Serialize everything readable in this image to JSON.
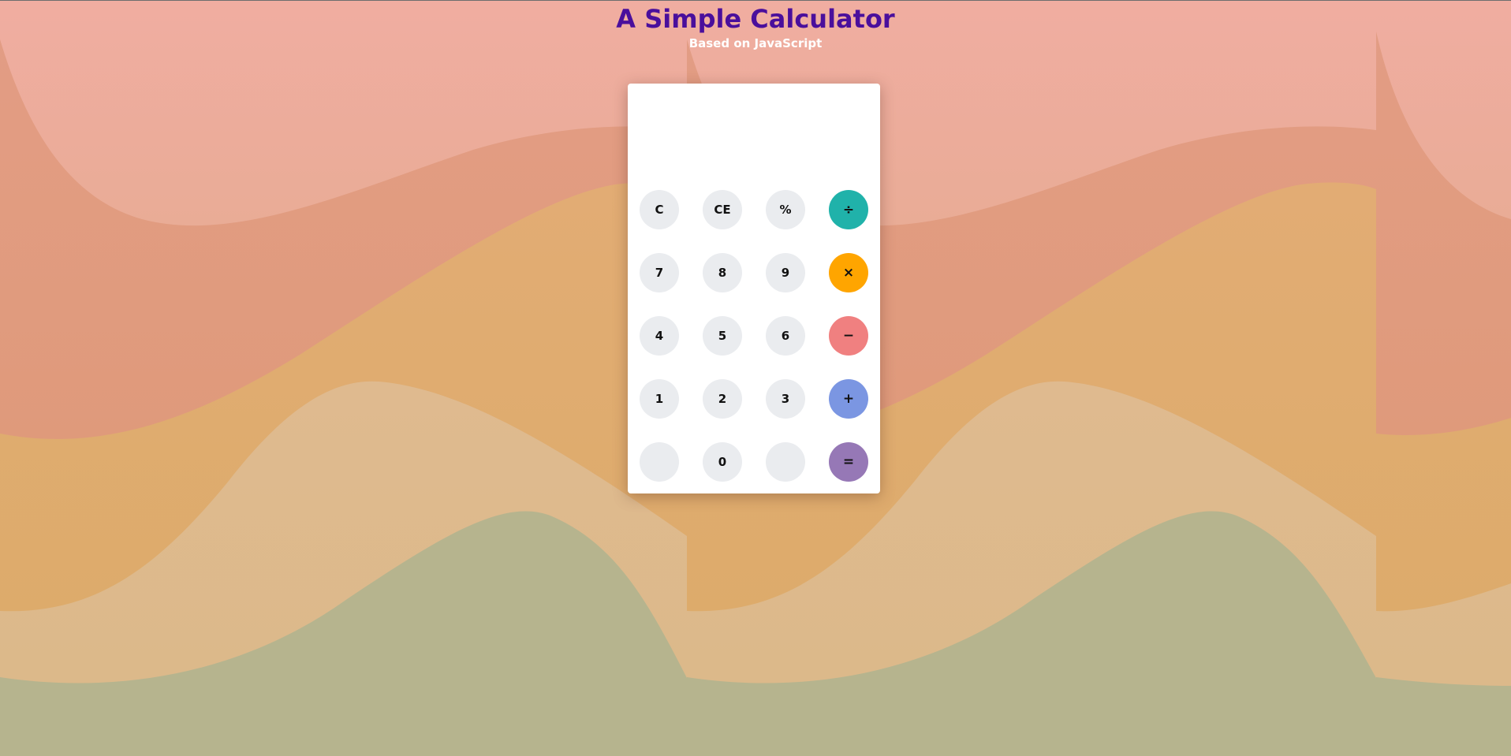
{
  "header": {
    "title": "A Simple Calculator",
    "subtitle": "Based on JavaScript"
  },
  "calculator": {
    "display_value": "",
    "keys": [
      {
        "label": "C",
        "color": "#eaecef"
      },
      {
        "label": "CE",
        "color": "#eaecef"
      },
      {
        "label": "%",
        "color": "#eaecef"
      },
      {
        "label": "÷",
        "color": "#20b2aa"
      },
      {
        "label": "7",
        "color": "#eaecef"
      },
      {
        "label": "8",
        "color": "#eaecef"
      },
      {
        "label": "9",
        "color": "#eaecef"
      },
      {
        "label": "×",
        "color": "#ffa500"
      },
      {
        "label": "4",
        "color": "#eaecef"
      },
      {
        "label": "5",
        "color": "#eaecef"
      },
      {
        "label": "6",
        "color": "#eaecef"
      },
      {
        "label": "−",
        "color": "#f08080"
      },
      {
        "label": "1",
        "color": "#eaecef"
      },
      {
        "label": "2",
        "color": "#eaecef"
      },
      {
        "label": "3",
        "color": "#eaecef"
      },
      {
        "label": "+",
        "color": "#7b96e2"
      },
      {
        "label": "",
        "color": "#eaecef"
      },
      {
        "label": "0",
        "color": "#eaecef"
      },
      {
        "label": "",
        "color": "#eaecef"
      },
      {
        "label": "=",
        "color": "#9678b6"
      }
    ]
  },
  "theme": {
    "title_color": "#4a0f9c",
    "subtitle_color": "#ffffff",
    "wave_colors": [
      "#efaea0",
      "#e39e82",
      "#e2ad70",
      "#e1b990",
      "#b6b48e"
    ]
  }
}
